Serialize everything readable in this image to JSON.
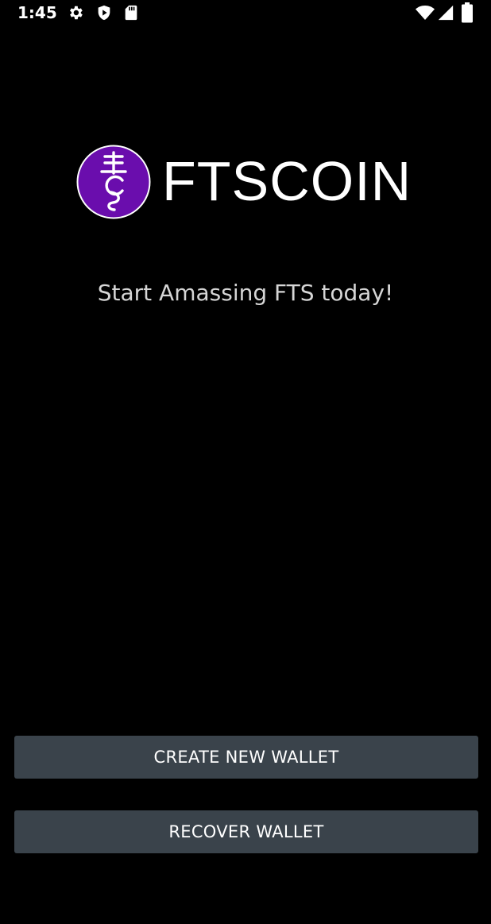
{
  "status_bar": {
    "time": "1:45",
    "icons": [
      "gear-icon",
      "shield-play-icon",
      "sd-card-icon",
      "wifi-icon",
      "cell-signal-icon",
      "battery-icon"
    ]
  },
  "brand": {
    "name": "FTSCOIN",
    "logo_icon": "ftscoin-logo-icon",
    "logo_color": "#6a0dad"
  },
  "tagline": "Start Amassing FTS today!",
  "buttons": {
    "create": "CREATE NEW WALLET",
    "recover": "RECOVER WALLET"
  },
  "colors": {
    "background": "#000000",
    "button": "#3a434b",
    "text": "#ffffff"
  }
}
